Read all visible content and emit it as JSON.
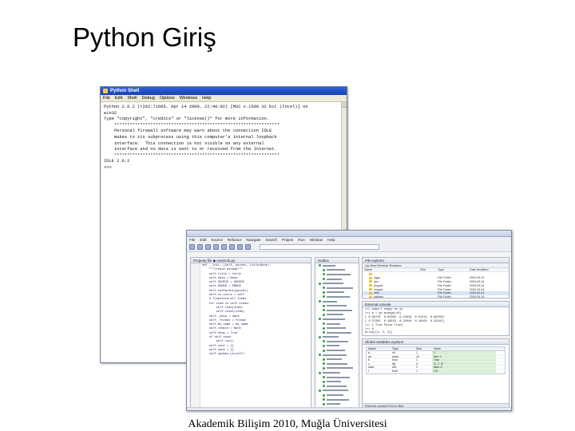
{
  "slide": {
    "title": "Python Giriş",
    "footer": "Akademik Bilişim 2010, Muğla Üniversitesi"
  },
  "python_shell": {
    "window_title": "Python Shell",
    "menu": [
      "File",
      "Edit",
      "Shell",
      "Debug",
      "Options",
      "Windows",
      "Help"
    ],
    "console_lines": [
      "Python 2.6.2 (r262:71605, Apr 14 2009, 22:40:02) [MSC v.1500 32 bit (Intel)] on",
      "win32",
      "Type \"copyright\", \"credits\" or \"license()\" for more information.",
      "",
      "    ****************************************************************",
      "    Personal firewall software may warn about the connection IDLE",
      "    makes to its subprocess using this computer's internal loopback",
      "    interface.  This connection is not visible on any external",
      "    interface and no data is sent to or received from the Internet.",
      "    ****************************************************************",
      "",
      "IDLE 2.6.2",
      ">>> "
    ]
  },
  "ide": {
    "menu": [
      "File",
      "Edit",
      "Source",
      "Refactor",
      "Navigate",
      "Search",
      "Project",
      "Run",
      "Window",
      "Help"
    ],
    "editor_tabs": "Property file   ◆ moreinfo.py",
    "code_lines": [
      "def __init__(self, parent, title=None):",
      "    \"\"\"Create window\"\"\"",
      "    self.title = title",
      "    self.data = None",
      "",
      "    self.SOURCE = SOURCE",
      "    self.DEBUG = DEBUG",
      "    self.setParent(parent)",
      "    self.cc_tools = self",
      "",
      "    # Transform all items",
      "    for item in self.items:",
      "        self.load(item)",
      "        self.reset(item)",
      "",
      "    self._data = data",
      "    self._format = format",
      "    self.my_name = my_name",
      "",
      "    self.remote = None",
      "    self.show = True",
      "    if self.show:",
      "        self.run()",
      "    self.conf = {}",
      "    self.save = {}",
      "",
      "    self.update_ui(self)"
    ],
    "explorer": {
      "tab": "File explorer",
      "toolbar": "Up   New   Refresh   Rename",
      "columns": [
        "Name",
        "Size",
        "Type",
        "Date Modified"
      ],
      "rows": [
        {
          "name": "..",
          "type": "",
          "date": "",
          "selected": false
        },
        {
          "name": "eggs",
          "type": "File Folder",
          "date": "2009-09-24",
          "selected": false
        },
        {
          "name": "doc",
          "type": "File Folder",
          "date": "2009-09-24",
          "selected": false
        },
        {
          "name": "plugins",
          "type": "File Folder",
          "date": "2009-09-24",
          "selected": false
        },
        {
          "name": "images",
          "type": "File Folder",
          "date": "2009-09-24",
          "selected": false
        },
        {
          "name": "utils",
          "type": "File Folder",
          "date": "2009-09-24",
          "selected": true
        },
        {
          "name": "widgets",
          "type": "File Folder",
          "date": "2009-09-24",
          "selected": false
        }
      ]
    },
    "console": {
      "tab": "External console",
      "lines": [
        ">>> import numpy as np",
        ">>> a = np.arange(10)",
        "[ 0.96176  0.93358  0.24619  0.01214  0.69703]",
        "[ 0.37282  0.18533  0.22018  0.16102  0.33102]",
        ">>> [ True False True]",
        ">>> b",
        "array([1, 2, 3])"
      ]
    },
    "variable_explorer": {
      "tab": "Global variables explorer",
      "columns": [
        "Name",
        "Type",
        "Size",
        "Value"
      ],
      "rows": [
        {
          "name": "a",
          "type": "int",
          "size": "1",
          "value": "1"
        },
        {
          "name": "arr",
          "type": "array",
          "size": "10",
          "value": "Min: 0"
        },
        {
          "name": "b",
          "type": "bool",
          "size": "1",
          "value": "True"
        },
        {
          "name": "c",
          "type": "list",
          "size": "3",
          "value": "[1, 2, 3]"
        },
        {
          "name": "data",
          "type": "dict",
          "size": "2",
          "value": "Max: 9"
        },
        {
          "name": "f",
          "type": "float",
          "size": "1",
          "value": "0.5"
        }
      ],
      "bottom_tabs": "External console   Find in files"
    },
    "outline_tab": "Outline"
  }
}
